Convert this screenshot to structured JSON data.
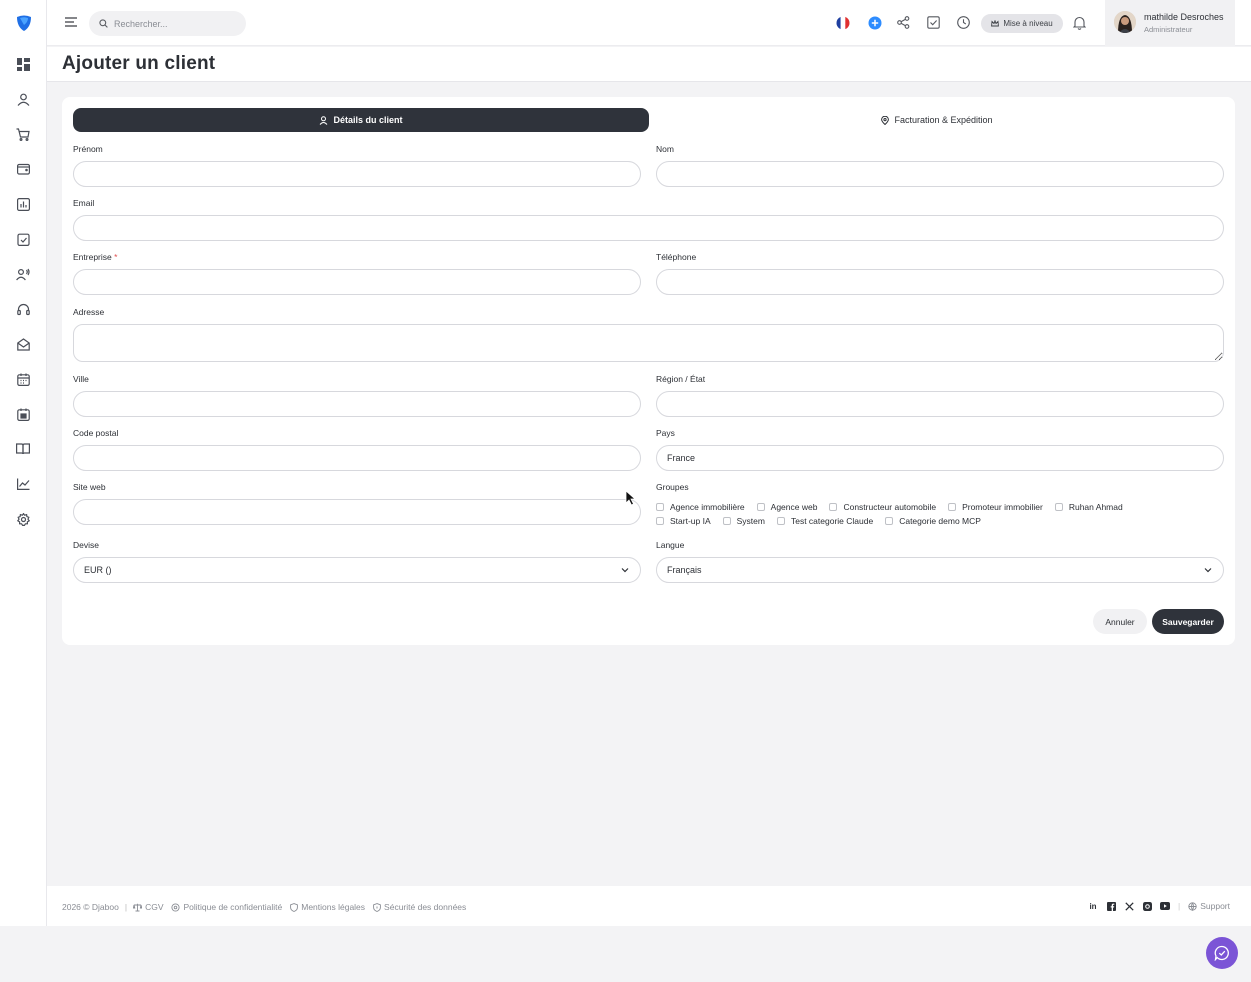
{
  "sidebar": {
    "items": [
      "dashboard-icon",
      "user-icon",
      "cart-icon",
      "wallet-icon",
      "chart-bar-icon",
      "clipboard-check-icon",
      "contacts-icon",
      "headset-icon",
      "mail-open-icon",
      "calendar-icon",
      "calendar-check-icon",
      "book-icon",
      "line-chart-icon",
      "settings-icon"
    ]
  },
  "topbar": {
    "search_placeholder": "Rechercher...",
    "upgrade_label": "Mise à niveau",
    "user_name": "mathilde Desroches",
    "user_role": "Administrateur"
  },
  "page": {
    "title": "Ajouter un client"
  },
  "tabs": {
    "details": "Détails du client",
    "billing": "Facturation & Expédition"
  },
  "form": {
    "first_name_label": "Prénom",
    "last_name_label": "Nom",
    "email_label": "Email",
    "company_label": "Entreprise",
    "company_required": "*",
    "phone_label": "Téléphone",
    "address_label": "Adresse",
    "city_label": "Ville",
    "region_label": "Région / État",
    "postal_label": "Code postal",
    "country_label": "Pays",
    "country_value": "France",
    "website_label": "Site web",
    "groups_label": "Groupes",
    "groups_row1": [
      "Agence immobilière",
      "Agence web",
      "Constructeur automobile",
      "Promoteur immobilier",
      "Ruhan Ahmad"
    ],
    "groups_row2": [
      "Start-up IA",
      "System",
      "Test categorie Claude",
      "Categorie demo MCP"
    ],
    "currency_label": "Devise",
    "currency_value": "EUR ()",
    "language_label": "Langue",
    "language_value": "Français",
    "cancel_label": "Annuler",
    "save_label": "Sauvegarder"
  },
  "footer": {
    "copyright": "2026 © Djaboo",
    "cgv": "CGV",
    "privacy": "Politique de confidentialité",
    "legal": "Mentions légales",
    "security": "Sécurité des données",
    "support": "Support",
    "socials": [
      "linkedin-icon",
      "facebook-icon",
      "x-icon",
      "instagram-icon",
      "youtube-icon"
    ]
  },
  "colors": {
    "primary_dark": "#2f333b",
    "chat_fab": "#7b54d6",
    "accent_blue": "#2d8cff"
  }
}
